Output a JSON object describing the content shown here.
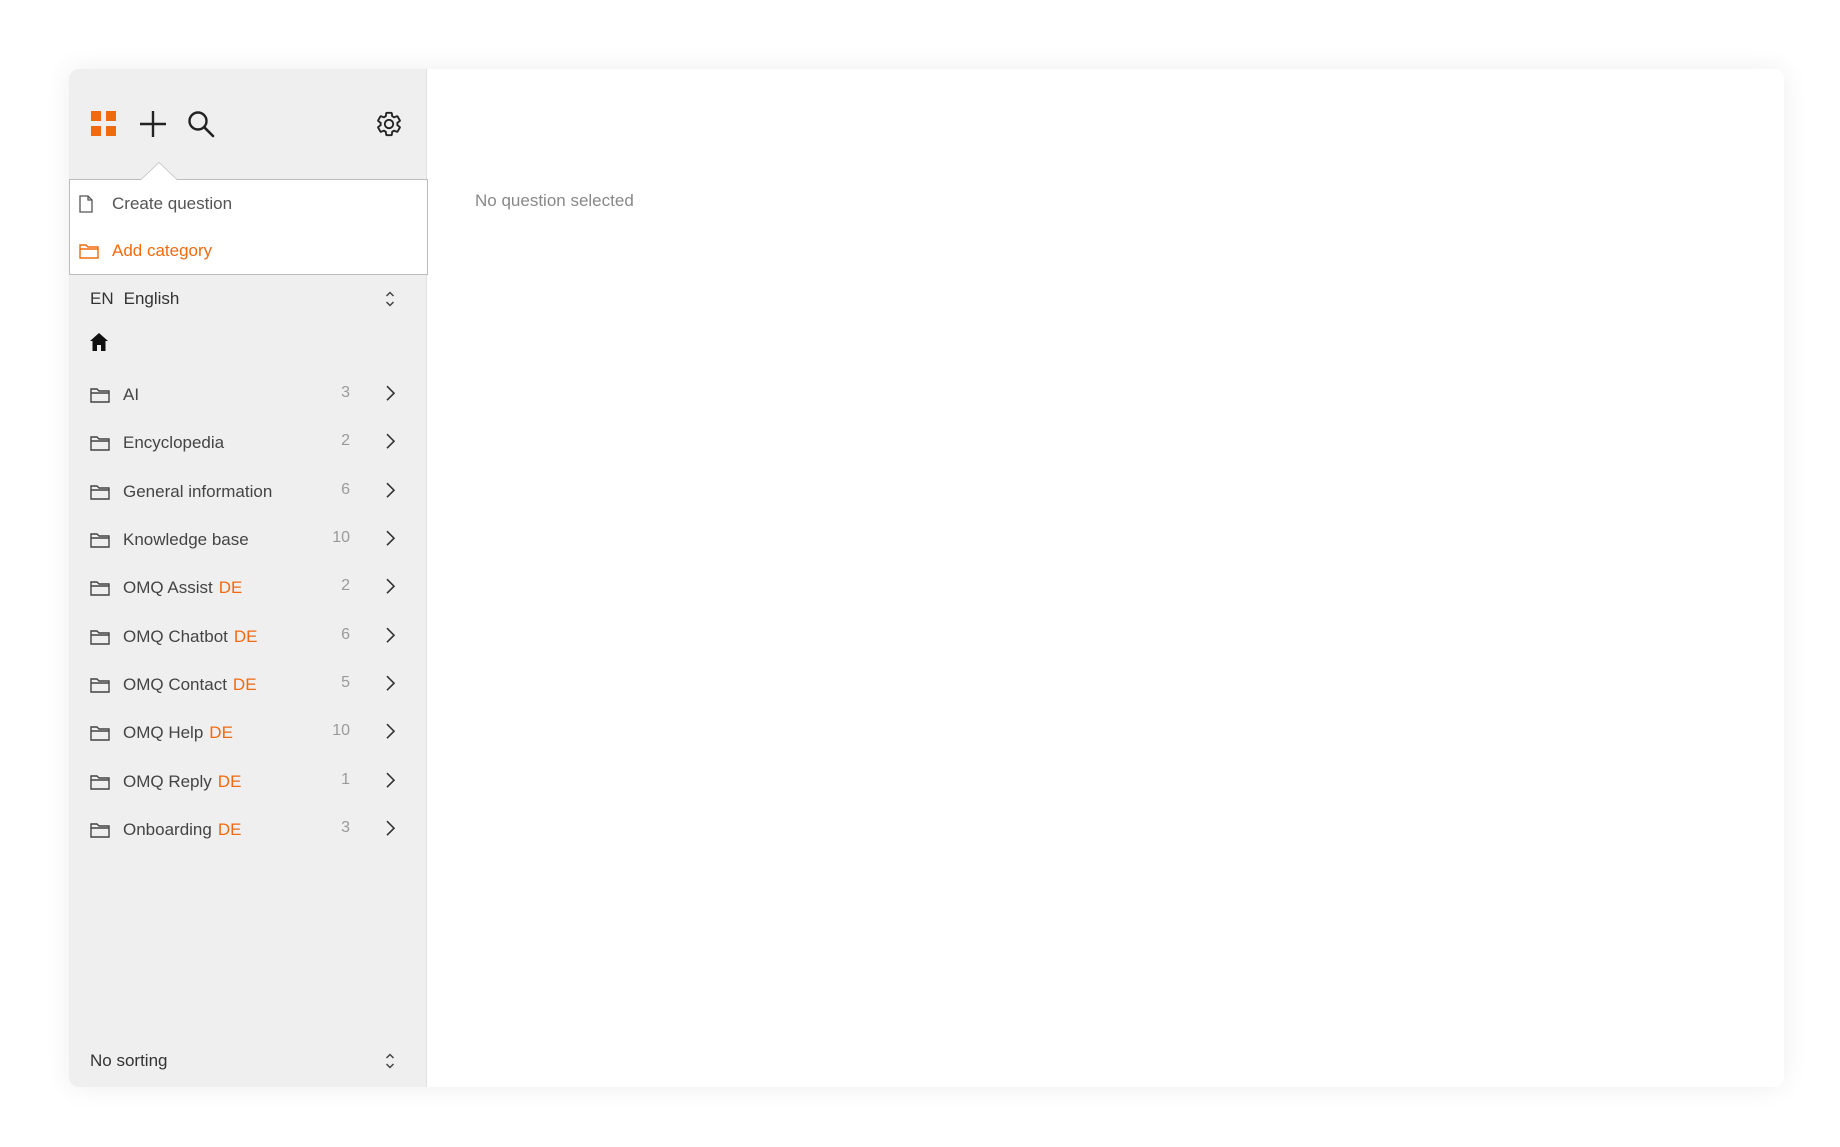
{
  "colors": {
    "accent": "#f26a10",
    "sidebar_bg": "#efefef"
  },
  "toolbar": {
    "apps_icon": "grid-icon",
    "add_icon": "plus-icon",
    "search_icon": "search-icon",
    "settings_icon": "gear-icon"
  },
  "add_menu": {
    "create_question": "Create question",
    "add_category": "Add category"
  },
  "language": {
    "code": "EN",
    "name": "English"
  },
  "categories": [
    {
      "name": "AI",
      "lang": "",
      "count": "3"
    },
    {
      "name": "Encyclopedia",
      "lang": "",
      "count": "2"
    },
    {
      "name": "General information",
      "lang": "",
      "count": "6"
    },
    {
      "name": "Knowledge base",
      "lang": "",
      "count": "10"
    },
    {
      "name": "OMQ Assist",
      "lang": "DE",
      "count": "2"
    },
    {
      "name": "OMQ Chatbot",
      "lang": "DE",
      "count": "6"
    },
    {
      "name": "OMQ Contact",
      "lang": "DE",
      "count": "5"
    },
    {
      "name": "OMQ Help",
      "lang": "DE",
      "count": "10"
    },
    {
      "name": "OMQ Reply",
      "lang": "DE",
      "count": "1"
    },
    {
      "name": "Onboarding",
      "lang": "DE",
      "count": "3"
    }
  ],
  "sorting": {
    "label": "No sorting"
  },
  "main": {
    "empty_text": "No question selected"
  }
}
